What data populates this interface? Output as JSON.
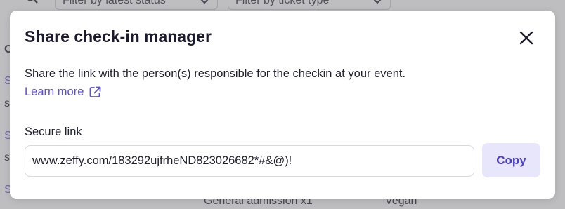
{
  "background": {
    "filter_status_label": "Filter by latest status",
    "filter_ticket_label": "Filter by ticket type",
    "left_fragments": [
      "C",
      "S",
      "s",
      "S",
      "s",
      "S"
    ],
    "row_ticket": "General admission x1",
    "row_option": "Vegan"
  },
  "modal": {
    "title": "Share check-in manager",
    "description": "Share the link with the person(s) responsible for the checkin at your event.",
    "learn_more": "Learn more",
    "secure_link_label": "Secure link",
    "secure_link_value": "www.zeffy.com/183292ujfrheND823026682*#&@)!",
    "copy_label": "Copy"
  },
  "colors": {
    "accent": "#5b50d6",
    "copy_button_bg": "#e8e6fb",
    "title": "#1b1b2f"
  },
  "icons": {
    "close": "close-icon",
    "external_link": "external-link-icon",
    "search": "search-icon",
    "chevron": "chevron-down-icon"
  }
}
